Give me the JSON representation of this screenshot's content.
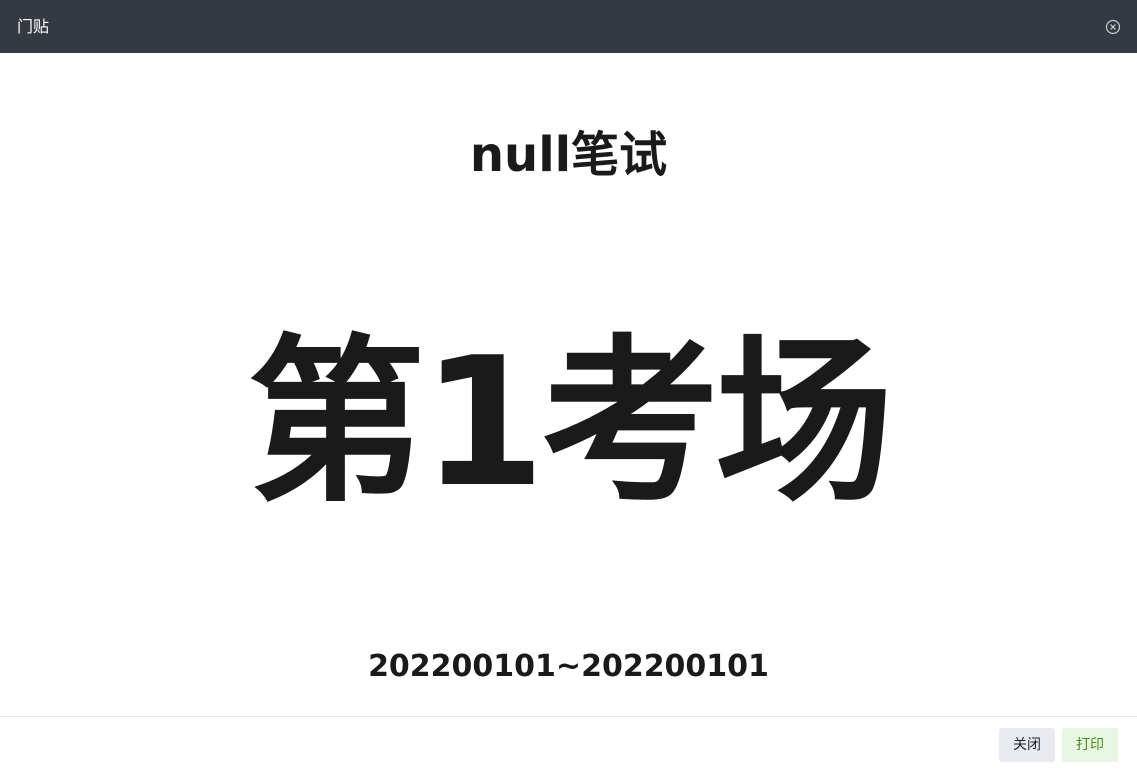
{
  "dialog": {
    "title": "门贴",
    "close_icon": "close-circle-icon"
  },
  "door_sign": {
    "exam_name": "null笔试",
    "room": "第1考场",
    "number_range": "202200101~202200101"
  },
  "footer": {
    "close_label": "关闭",
    "print_label": "打印"
  },
  "colors": {
    "titlebar": "#353a42",
    "print_button_bg": "#e8f5e1",
    "print_button_text": "#4a8a1f"
  }
}
